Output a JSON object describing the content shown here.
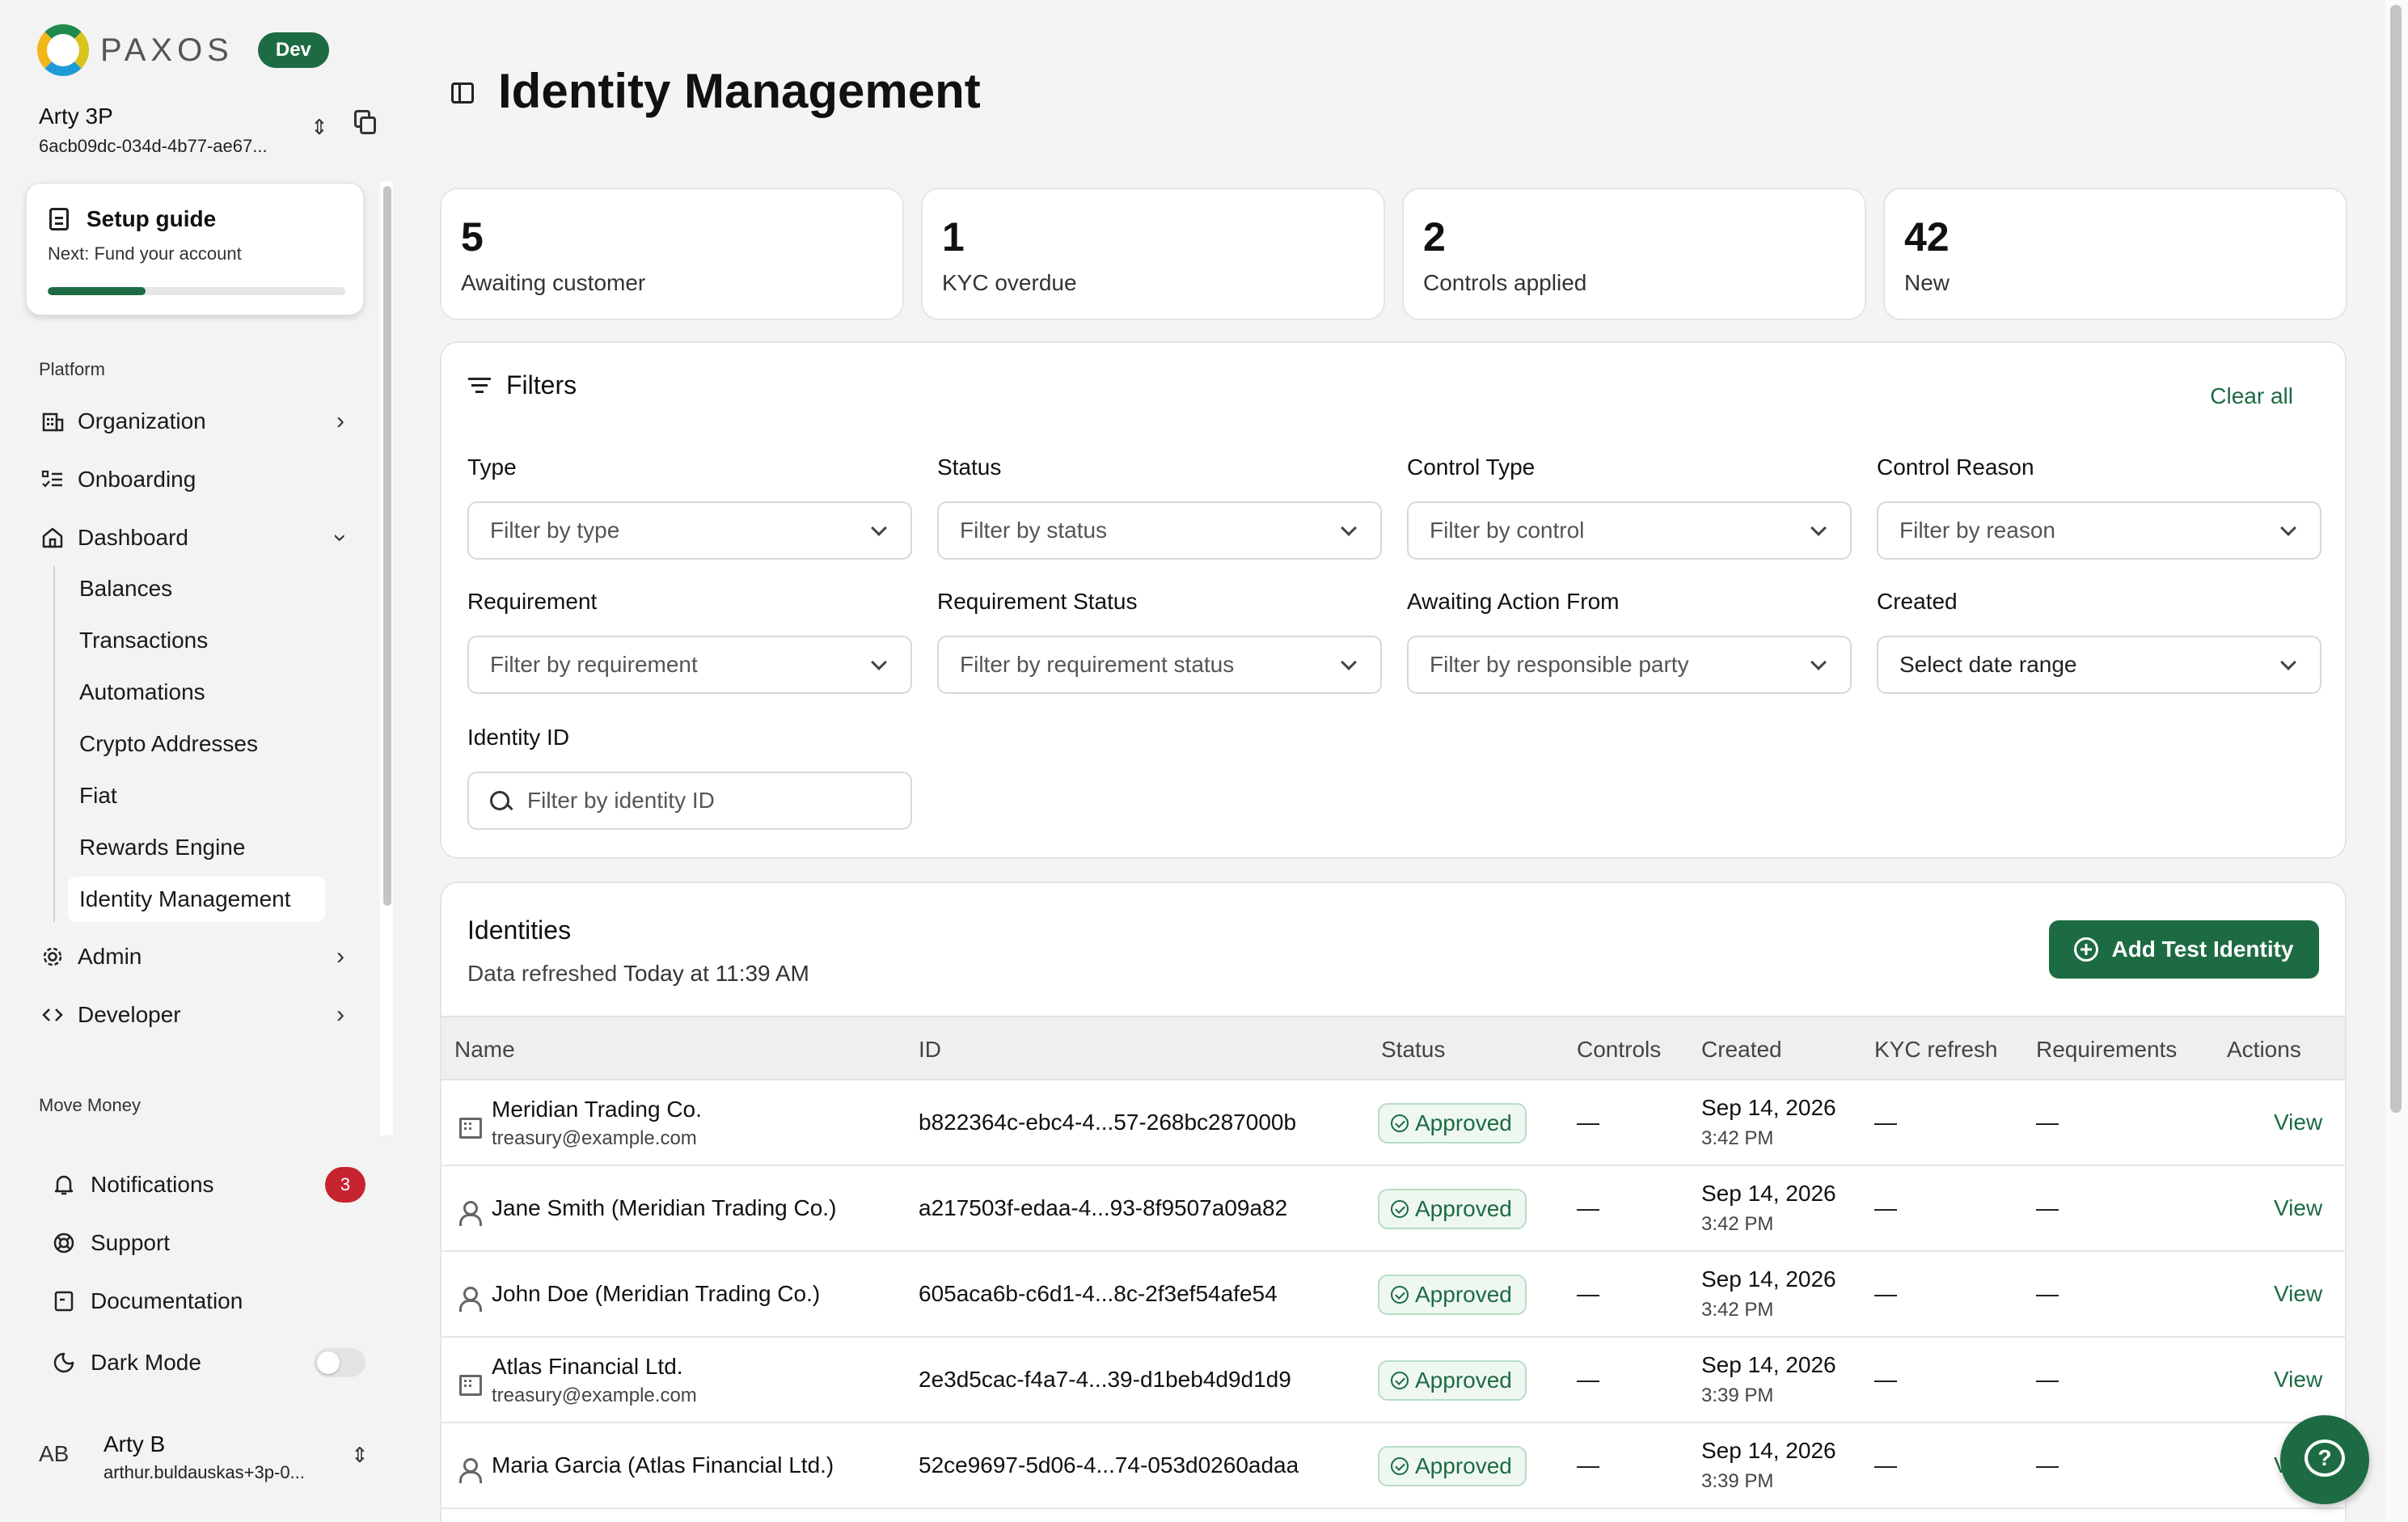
{
  "app": {
    "brand": "PAXOS",
    "env_badge": "Dev"
  },
  "account": {
    "name": "Arty 3P",
    "id": "6acb09dc-034d-4b77-ae67..."
  },
  "setup": {
    "title": "Setup guide",
    "next": "Next: Fund your account",
    "progress": 0.33
  },
  "sidebar": {
    "platform_label": "Platform",
    "organization": "Organization",
    "onboarding": "Onboarding",
    "dashboard": "Dashboard",
    "sub": [
      "Balances",
      "Transactions",
      "Automations",
      "Crypto Addresses",
      "Fiat",
      "Rewards Engine",
      "Identity Management"
    ],
    "active_sub": "Identity Management",
    "admin": "Admin",
    "developer": "Developer",
    "move_money_label": "Move Money",
    "notifications": "Notifications",
    "notifications_count": "3",
    "support": "Support",
    "documentation": "Documentation",
    "dark_mode": "Dark Mode",
    "dark_mode_on": false
  },
  "user": {
    "initials": "AB",
    "name": "Arty B",
    "email": "arthur.buldauskas+3p-0..."
  },
  "page": {
    "title": "Identity Management"
  },
  "stats": [
    {
      "value": "5",
      "label": "Awaiting customer"
    },
    {
      "value": "1",
      "label": "KYC overdue"
    },
    {
      "value": "2",
      "label": "Controls applied"
    },
    {
      "value": "42",
      "label": "New"
    }
  ],
  "filters": {
    "title": "Filters",
    "clear_all": "Clear all",
    "type": {
      "label": "Type",
      "placeholder": "Filter by type"
    },
    "status": {
      "label": "Status",
      "placeholder": "Filter by status"
    },
    "control_type": {
      "label": "Control Type",
      "placeholder": "Filter by control"
    },
    "control_reason": {
      "label": "Control Reason",
      "placeholder": "Filter by reason"
    },
    "requirement": {
      "label": "Requirement",
      "placeholder": "Filter by requirement"
    },
    "requirement_status": {
      "label": "Requirement Status",
      "placeholder": "Filter by requirement status"
    },
    "awaiting_action": {
      "label": "Awaiting Action From",
      "placeholder": "Filter by responsible party"
    },
    "created": {
      "label": "Created",
      "placeholder": "Select date range"
    },
    "identity_id": {
      "label": "Identity ID",
      "placeholder": "Filter by identity ID"
    }
  },
  "identities": {
    "title": "Identities",
    "refreshed_prefix": "Data refreshed",
    "refreshed_time": "Today at 11:39 AM",
    "add_button": "Add Test Identity",
    "columns": [
      "Name",
      "ID",
      "Status",
      "Controls",
      "Created",
      "KYC refresh",
      "Requirements",
      "Actions"
    ],
    "rows": [
      {
        "icon": "organization-icon",
        "name": "Meridian Trading Co.",
        "email": "treasury@example.com",
        "id": "b822364c-ebc4-4...57-268bc287000b",
        "status": "Approved",
        "controls": "—",
        "created_date": "Sep 14, 2026",
        "created_time": "3:42 PM",
        "kyc_refresh": "—",
        "requirements": "—",
        "action": "View"
      },
      {
        "icon": "person-icon",
        "name": "Jane Smith (Meridian Trading Co.)",
        "email": "",
        "id": "a217503f-edaa-4...93-8f9507a09a82",
        "status": "Approved",
        "controls": "—",
        "created_date": "Sep 14, 2026",
        "created_time": "3:42 PM",
        "kyc_refresh": "—",
        "requirements": "—",
        "action": "View"
      },
      {
        "icon": "person-icon",
        "name": "John Doe (Meridian Trading Co.)",
        "email": "",
        "id": "605aca6b-c6d1-4...8c-2f3ef54afe54",
        "status": "Approved",
        "controls": "—",
        "created_date": "Sep 14, 2026",
        "created_time": "3:42 PM",
        "kyc_refresh": "—",
        "requirements": "—",
        "action": "View"
      },
      {
        "icon": "organization-icon",
        "name": "Atlas Financial Ltd.",
        "email": "treasury@example.com",
        "id": "2e3d5cac-f4a7-4...39-d1beb4d9d1d9",
        "status": "Approved",
        "controls": "—",
        "created_date": "Sep 14, 2026",
        "created_time": "3:39 PM",
        "kyc_refresh": "—",
        "requirements": "—",
        "action": "View"
      },
      {
        "icon": "person-icon",
        "name": "Maria Garcia (Atlas Financial Ltd.)",
        "email": "",
        "id": "52ce9697-5d06-4...74-053d0260adaa",
        "status": "Approved",
        "controls": "—",
        "created_date": "Sep 14, 2026",
        "created_time": "3:39 PM",
        "kyc_refresh": "—",
        "requirements": "—",
        "action": "View"
      }
    ]
  },
  "help": {
    "label": "?"
  },
  "colors": {
    "brand_green": "#1d6b43",
    "badge_red": "#c8242f",
    "approved_bg": "#eef8f1"
  }
}
